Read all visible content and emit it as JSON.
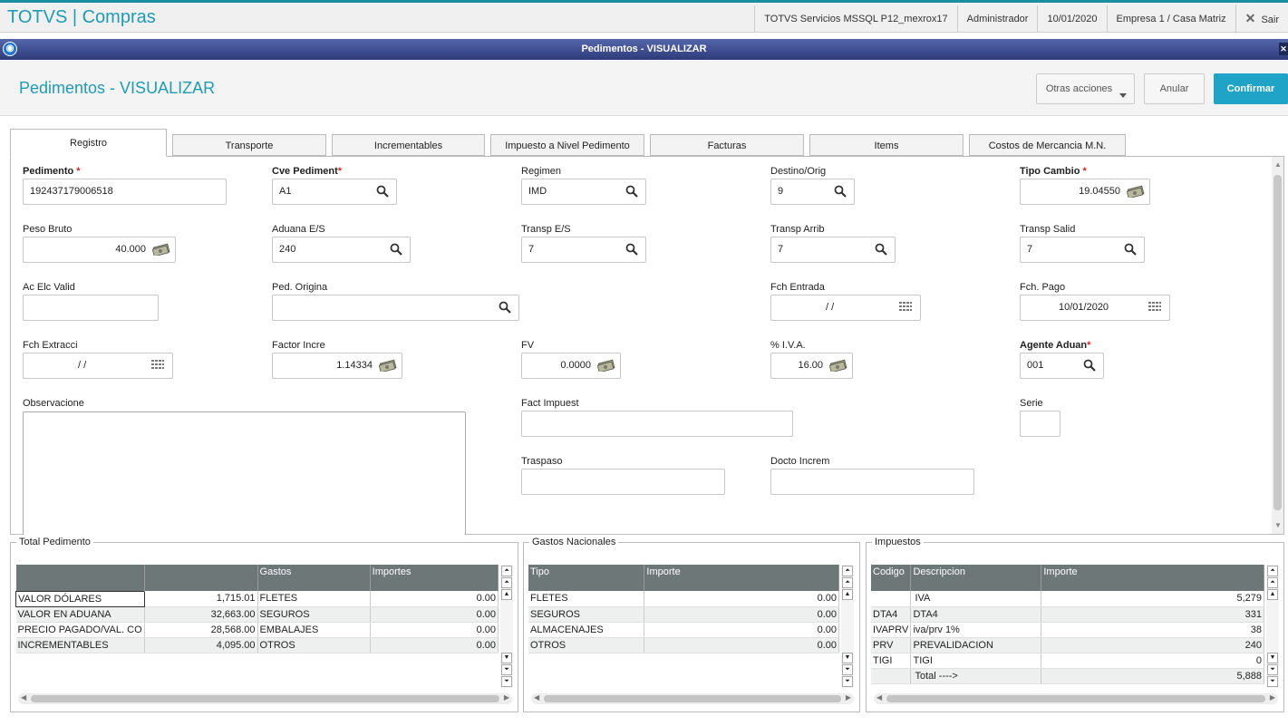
{
  "app": {
    "brand": "TOTVS | Compras",
    "env": "TOTVS Servicios MSSQL P12_mexrox17",
    "user": "Administrador",
    "date": "10/01/2020",
    "company": "Empresa 1 / Casa Matriz",
    "exit_label": "Sair"
  },
  "window": {
    "title": "Pedimentos - VISUALIZAR"
  },
  "header": {
    "title": "Pedimentos - VISUALIZAR",
    "other_actions": "Otras acciones",
    "cancel": "Anular",
    "confirm": "Confirmar"
  },
  "tabs": [
    "Registro",
    "Transporte",
    "Incrementables",
    "Impuesto a Nivel Pedimento",
    "Facturas",
    "Items",
    "Costos de Mercancia M.N."
  ],
  "form": {
    "pedimento": {
      "label": "Pedimento",
      "required": "*",
      "value": "192437179006518"
    },
    "cve_pediment": {
      "label": "Cve Pediment",
      "required": "*",
      "value": "A1"
    },
    "regimen": {
      "label": "Regimen",
      "value": "IMD"
    },
    "destino_orig": {
      "label": "Destino/Orig",
      "value": "9"
    },
    "tipo_cambio": {
      "label": "Tipo Cambio",
      "required": "*",
      "value": "19.04550"
    },
    "peso_bruto": {
      "label": "Peso Bruto",
      "value": "40.000"
    },
    "aduana_es": {
      "label": "Aduana E/S",
      "value": "240"
    },
    "transp_es": {
      "label": "Transp E/S",
      "value": "7"
    },
    "transp_arrib": {
      "label": "Transp Arrib",
      "value": "7"
    },
    "transp_salid": {
      "label": "Transp Salid",
      "value": "7"
    },
    "ac_elc_valid": {
      "label": "Ac Elc Valid",
      "value": ""
    },
    "ped_origina": {
      "label": "Ped. Origina",
      "value": ""
    },
    "fch_entrada": {
      "label": "Fch Entrada",
      "value": "/ /"
    },
    "fch_pago": {
      "label": "Fch. Pago",
      "value": "10/01/2020"
    },
    "fch_extracci": {
      "label": "Fch Extracci",
      "value": "/ /"
    },
    "factor_incre": {
      "label": "Factor Incre",
      "value": "1.14334"
    },
    "fv": {
      "label": "FV",
      "value": "0.0000"
    },
    "iva": {
      "label": "% I.V.A.",
      "value": "16.00"
    },
    "agente_aduan": {
      "label": "Agente Aduan",
      "required": "*",
      "value": "001"
    },
    "observacione": {
      "label": "Observacione",
      "value": ""
    },
    "fact_impuest": {
      "label": "Fact Impuest",
      "value": ""
    },
    "serie": {
      "label": "Serie",
      "value": ""
    },
    "traspaso": {
      "label": "Traspaso",
      "value": ""
    },
    "docto_increm": {
      "label": "Docto Increm",
      "value": ""
    }
  },
  "total_pedimento": {
    "title": "Total Pedimento",
    "headers": [
      "",
      "",
      "Gastos",
      "Importes"
    ],
    "rows": [
      [
        "VALOR DÓLARES",
        "1,715.01",
        "FLETES",
        "0.00"
      ],
      [
        "VALOR EN ADUANA",
        "32,663.00",
        "SEGUROS",
        "0.00"
      ],
      [
        "PRECIO PAGADO/VAL. CO",
        "28,568.00",
        "EMBALAJES",
        "0.00"
      ],
      [
        "INCREMENTABLES",
        "4,095.00",
        "OTROS",
        "0.00"
      ]
    ]
  },
  "gastos_nacionales": {
    "title": "Gastos Nacionales",
    "headers": [
      "Tipo",
      "Importe"
    ],
    "rows": [
      [
        "FLETES",
        "0.00"
      ],
      [
        "SEGUROS",
        "0.00"
      ],
      [
        "ALMACENAJES",
        "0.00"
      ],
      [
        "OTROS",
        "0.00"
      ]
    ]
  },
  "impuestos": {
    "title": "Impuestos",
    "headers": [
      "Codigo",
      "Descripcion",
      "Importe"
    ],
    "rows": [
      [
        "",
        "IVA",
        "5,279"
      ],
      [
        "DTA4",
        "DTA4",
        "331"
      ],
      [
        "IVAPRV",
        "iva/prv 1%",
        "38"
      ],
      [
        "PRV",
        "PREVALIDACION",
        "240"
      ],
      [
        "TIGI",
        "TIGI",
        "0"
      ],
      [
        "",
        "Total ---->",
        "5,888"
      ]
    ]
  },
  "colors": {
    "accent": "#1f9bb3",
    "primary_button": "#1fa3c7",
    "title_bar": "#3a4a8a",
    "grid_header": "#6d7778"
  },
  "icons": {
    "lookup": "search-icon",
    "currency": "money-icon",
    "calendar": "calendar-icon"
  }
}
